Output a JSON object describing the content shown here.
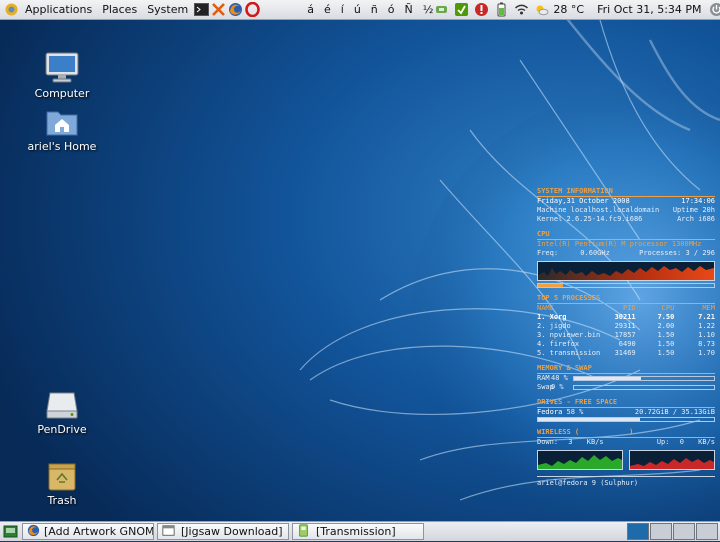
{
  "top_panel": {
    "menus": [
      "Applications",
      "Places",
      "System"
    ],
    "launchers": [
      "terminal-icon",
      "tools-icon",
      "firefox-icon",
      "opera-icon"
    ],
    "chars": [
      "á",
      "é",
      "í",
      "ú",
      "ñ",
      "ó",
      "Ñ",
      "½"
    ],
    "temperature": "28 °C",
    "clock": "Fri Oct 31,  5:34 PM"
  },
  "desktop_icons": [
    {
      "label": "Computer"
    },
    {
      "label": "ariel's Home"
    },
    {
      "label": "PenDrive"
    },
    {
      "label": "Trash"
    }
  ],
  "conky": {
    "sysinfo": {
      "title": "SYSTEM INFORMATION",
      "date": "Friday,31 October 2008",
      "time": "17:34:06",
      "machine_label": "Machine",
      "machine": "localhost.localdomain",
      "uptime_label": "Uptime",
      "uptime": "20h",
      "kernel_label": "Kernel",
      "kernel": "2.6.25-14.fc9.i686",
      "arch_label": "Arch",
      "arch": "i686"
    },
    "cpu": {
      "title": "CPU",
      "model": "Intel(R) Pentium(R) M processor 1300MHz",
      "freq_label": "Freq:",
      "freq": "0.60GHz",
      "proc_label": "Processes:",
      "processes": "3 / 296",
      "bar_fraction": 0.14
    },
    "top": {
      "title": "TOP 5 PROCESSES",
      "headers": [
        "NAME",
        "PID",
        "CPU",
        "MEM"
      ],
      "rows": [
        {
          "name": "1. Xorg",
          "pid": "30211",
          "cpu": "7.50",
          "mem": "7.21"
        },
        {
          "name": "2. jigdo",
          "pid": "29311",
          "cpu": "2.00",
          "mem": "1.22"
        },
        {
          "name": "3. npviewer.bin",
          "pid": "17857",
          "cpu": "1.50",
          "mem": "1.10"
        },
        {
          "name": "4. firefox",
          "pid": "6490",
          "cpu": "1.50",
          "mem": "8.73"
        },
        {
          "name": "5. transmission",
          "pid": "31469",
          "cpu": "1.50",
          "mem": "1.70"
        }
      ]
    },
    "memory": {
      "title": "MEMORY & SWAP",
      "ram_label": "RAM",
      "ram": "48 %",
      "ram_fraction": 0.48,
      "swap_label": "Swap",
      "swap": "0 %",
      "swap_fraction": 0.0
    },
    "drives": {
      "title": "DRIVES - FREE SPACE",
      "name": "Fedora",
      "percent": "58 %",
      "usage": "20.72GiB / 35.13GiB",
      "fraction": 0.58
    },
    "wireless": {
      "title": "WIRELESS (",
      "title_end": ")",
      "down_label": "Down:",
      "down": "3",
      "down_unit": "KB/s",
      "up_label": "Up:",
      "up": "0",
      "up_unit": "KB/s"
    },
    "footer": "ariel@fedora 9 (Sulphur)"
  },
  "bottom_panel": {
    "tasks": [
      "[Add Artwork GNOM...",
      "[Jigsaw Download]",
      "[Transmission]"
    ],
    "workspaces": 4,
    "active_workspace": 1
  },
  "colors": {
    "conky_accent": "#f0a040",
    "wallpaper_base": "#0d3f78"
  }
}
